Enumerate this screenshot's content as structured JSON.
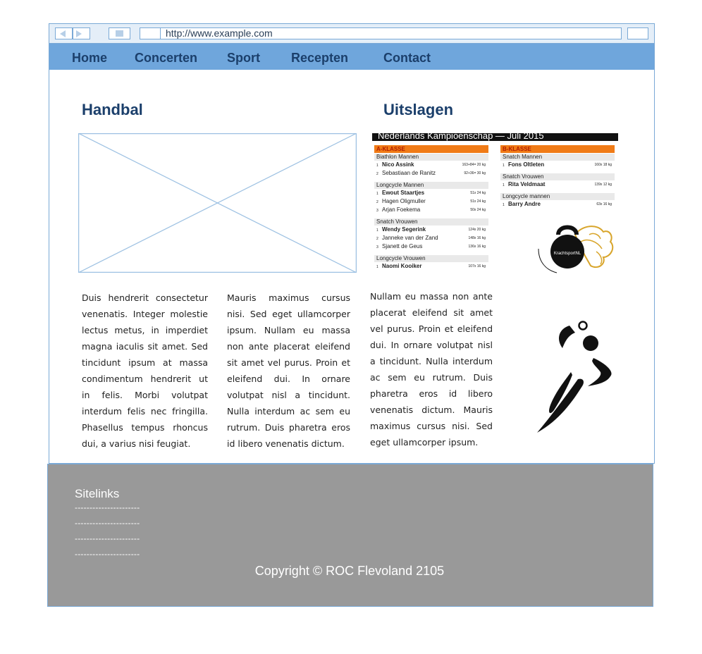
{
  "browser": {
    "url": "http://www.example.com"
  },
  "nav": {
    "items": [
      "Home",
      "Concerten",
      "Sport",
      "Recepten",
      "Contact"
    ]
  },
  "main": {
    "left_title": "Handbal",
    "right_title": "Uitslagen",
    "col1": "Duis hendrerit consectetur venenatis. Integer molestie lectus metus, in imperdiet magna iaculis sit amet. Sed tincidunt ipsum at massa condimentum hendrerit ut in felis. Morbi volutpat interdum felis nec fringilla. Phasellus tempus rhoncus dui, a varius nisi feugiat.",
    "col2": "Mauris maximus cursus nisi. Sed eget ullamcorper ipsum. Nullam eu massa non ante placerat eleifend sit amet vel purus. Proin et eleifend dui. In ornare volutpat nisl a tincidunt. Nulla interdum ac sem eu rutrum. Duis pharetra eros id libero venenatis dictum.",
    "col3": "Nullam eu massa non ante placerat eleifend sit amet vel purus. Proin et eleifend dui. In ornare volutpat nisl a tincidunt. Nulla interdum ac sem eu rutrum. Duis pharetra eros id libero venenatis dictum. Mauris maximus cursus nisi. Sed eget ullamcorper ipsum."
  },
  "results": {
    "banner": "Nederlands Kampioenschap — Juli 2015",
    "a_header": "A-KLASSE",
    "b_header": "B-KLASSE",
    "a_groups": [
      {
        "cat": "Biathlon Mannen",
        "rows": [
          [
            "1",
            "Nico Assink",
            "163+84= 20 kg"
          ],
          [
            "2",
            "Sebastiaan de Ranitz",
            "92+36= 30 kg"
          ]
        ]
      },
      {
        "cat": "Longcycle Mannen",
        "rows": [
          [
            "1",
            "Ewout Staartjes",
            "51x 24 kg"
          ],
          [
            "2",
            "Hagen Oligmuller",
            "51x 24 kg"
          ],
          [
            "3",
            "Arjan Foekema",
            "50x 24 kg"
          ]
        ]
      },
      {
        "cat": "Snatch Vrouwen",
        "rows": [
          [
            "1",
            "Wendy Segerink",
            "124x 20 kg"
          ],
          [
            "2",
            "Janneke van der Zand",
            "148x 16 kg"
          ],
          [
            "3",
            "Sjanett de Geus",
            "136x 16 kg"
          ]
        ]
      },
      {
        "cat": "Longcycle Vrouwen",
        "rows": [
          [
            "1",
            "Naomi Kooiker",
            "107x 16 kg"
          ]
        ]
      }
    ],
    "b_groups": [
      {
        "cat": "Snatch Mannen",
        "rows": [
          [
            "1",
            "Fons Oltleten",
            "160x 18 kg"
          ]
        ]
      },
      {
        "cat": "Snatch Vrouwen",
        "rows": [
          [
            "1",
            "Rita Veldmaat",
            "139x 12 kg"
          ]
        ]
      },
      {
        "cat": "Longcycle mannen",
        "rows": [
          [
            "1",
            "Barry Andre",
            "63x 16 kg"
          ]
        ]
      }
    ],
    "logo_text": "KrachtsportNL"
  },
  "footer": {
    "sitelinks_title": "Sitelinks",
    "links": [
      "----------------------",
      "----------------------",
      "----------------------",
      "----------------------"
    ],
    "copyright": "Copyright © ROC Flevoland 2105"
  },
  "colors": {
    "nav_bg": "#6fa6dc",
    "heading": "#1b3f6b",
    "footer_bg": "#999999",
    "frame_border": "#7aa9d6"
  }
}
